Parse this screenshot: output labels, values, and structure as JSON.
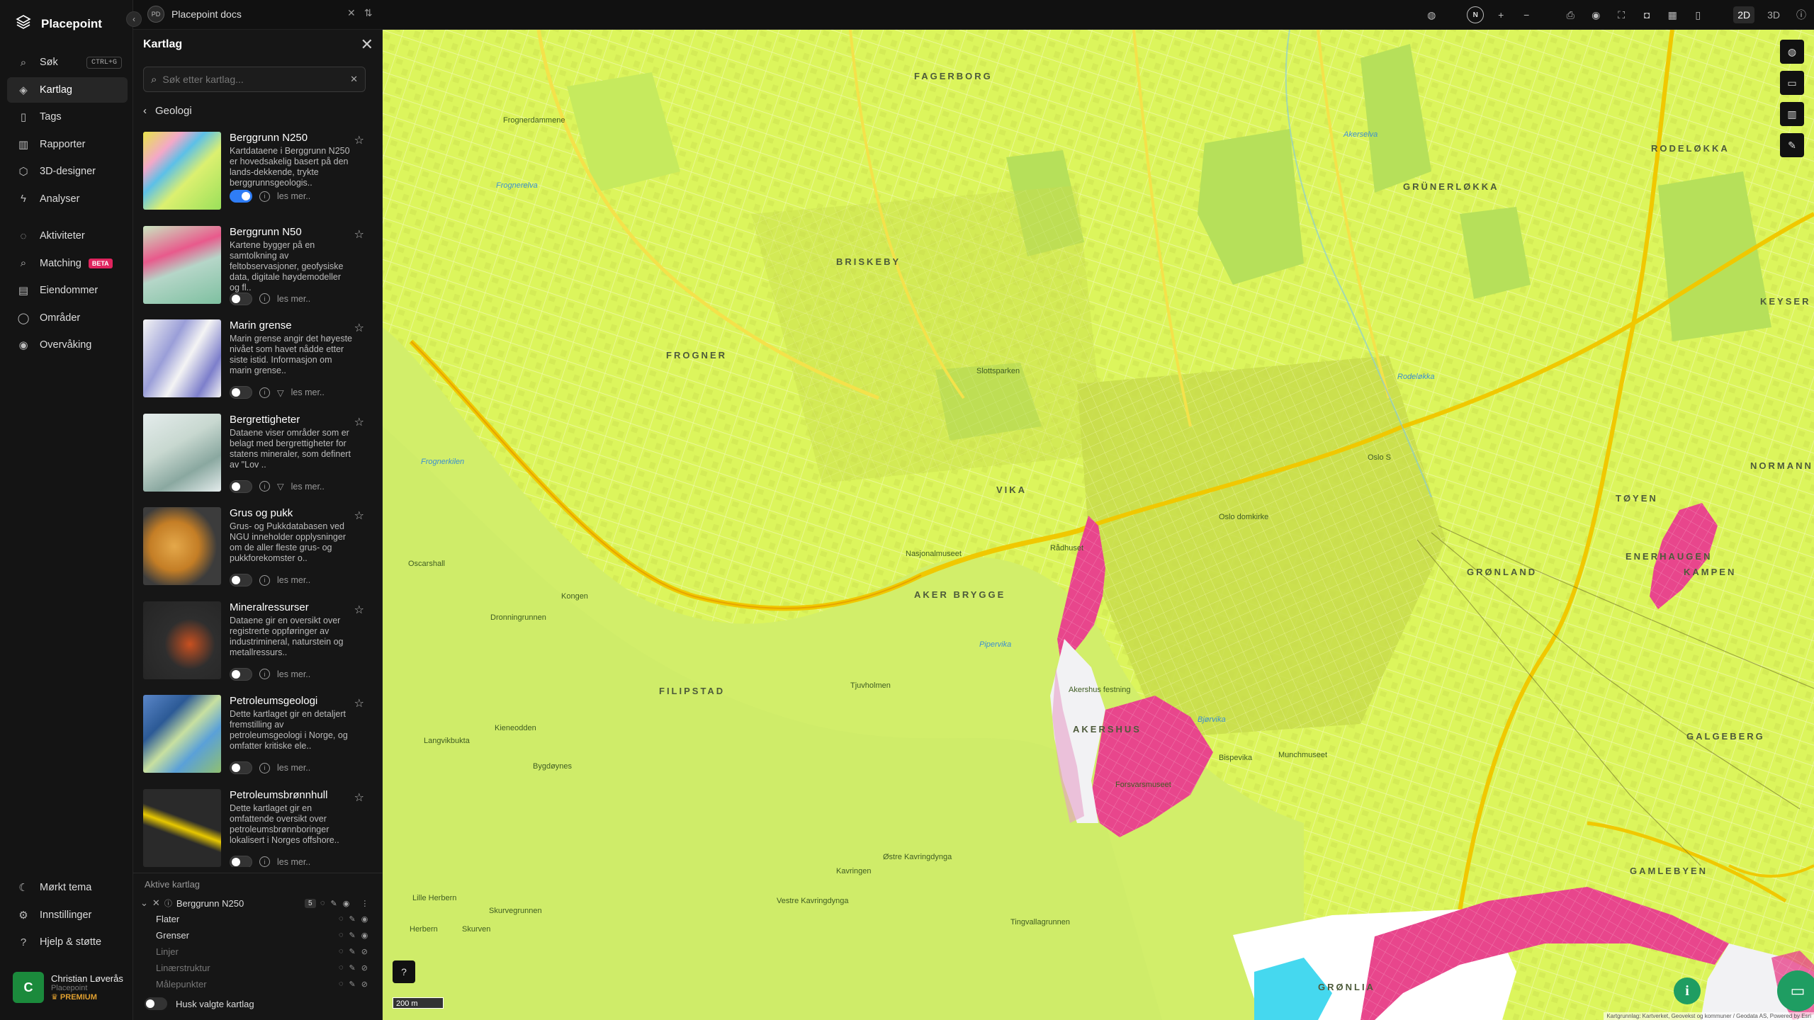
{
  "app": {
    "brand": "Placepoint",
    "document": {
      "badge": "PD",
      "title": "Placepoint docs"
    }
  },
  "nav": {
    "items": [
      {
        "label": "Søk",
        "shortcut": "CTRL+G",
        "icon": "search-icon"
      },
      {
        "label": "Kartlag",
        "icon": "layers-icon",
        "active": true
      },
      {
        "label": "Tags",
        "icon": "bookmark-icon"
      },
      {
        "label": "Rapporter",
        "icon": "bar-chart-icon"
      },
      {
        "label": "3D-designer",
        "icon": "cube-icon"
      },
      {
        "label": "Analyser",
        "icon": "bolt-icon"
      }
    ],
    "items2": [
      {
        "label": "Aktiviteter",
        "icon": "activity-icon"
      },
      {
        "label": "Matching",
        "badge": "BETA",
        "icon": "match-icon"
      },
      {
        "label": "Eiendommer",
        "icon": "building-icon"
      },
      {
        "label": "Områder",
        "icon": "area-icon"
      },
      {
        "label": "Overvåking",
        "icon": "monitor-icon"
      }
    ],
    "bottom": [
      {
        "label": "Mørkt tema",
        "icon": "moon-icon"
      },
      {
        "label": "Innstillinger",
        "icon": "gear-icon"
      },
      {
        "label": "Hjelp & støtte",
        "icon": "help-icon"
      }
    ],
    "user": {
      "initial": "C",
      "name": "Christian Løverås",
      "org": "Placepoint",
      "tier": "PREMIUM"
    }
  },
  "toolbar": {
    "mode_2d": "2D",
    "mode_3d": "3D",
    "compass": "N"
  },
  "panel": {
    "title": "Kartlag",
    "search_placeholder": "Søk etter kartlag...",
    "breadcrumb": "Geologi",
    "layers": [
      {
        "title": "Berggrunn N250",
        "desc": "Kartdataene i Berggrunn N250 er hovedsakelig basert på den lands-dekkende, trykte berggrunnsgeologis..",
        "more": "les mer..",
        "on": true,
        "filter": false
      },
      {
        "title": "Berggrunn N50",
        "desc": "Kartene bygger på en samtolkning av feltobservasjoner, geofysiske data, digitale høydemodeller og fl..",
        "more": "les mer..",
        "on": false,
        "filter": false
      },
      {
        "title": "Marin grense",
        "desc": "Marin grense angir det høyeste nivået som havet nådde etter siste istid. Informasjon om marin grense..",
        "more": "les mer..",
        "on": false,
        "filter": true
      },
      {
        "title": "Bergrettigheter",
        "desc": "Dataene viser områder som er belagt med bergrettigheter for statens mineraler, som definert av \"Lov ..",
        "more": "les mer..",
        "on": false,
        "filter": true
      },
      {
        "title": "Grus og pukk",
        "desc": "Grus- og Pukkdatabasen ved NGU inneholder opplysninger om de aller fleste grus- og pukkforekomster o..",
        "more": "les mer..",
        "on": false,
        "filter": false
      },
      {
        "title": "Mineralressurser",
        "desc": "Dataene gir en oversikt over registrerte oppføringer av industrimineral, naturstein og metallressurs..",
        "more": "les mer..",
        "on": false,
        "filter": false
      },
      {
        "title": "Petroleumsgeologi",
        "desc": "Dette kartlaget gir en detaljert fremstilling av petroleumsgeologi i Norge, og omfatter kritiske ele..",
        "more": "les mer..",
        "on": false,
        "filter": false
      },
      {
        "title": "Petroleumsbrønnhull",
        "desc": "Dette kartlaget gir en omfattende oversikt over petroleumsbrønnboringer lokalisert i Norges offshore..",
        "more": "les mer..",
        "on": false,
        "filter": false
      }
    ],
    "active_title": "Aktive kartlag",
    "active_layer": {
      "name": "Berggrunn N250",
      "count": "5"
    },
    "sublayers": [
      {
        "name": "Flater",
        "dim": false
      },
      {
        "name": "Grenser",
        "dim": false
      },
      {
        "name": "Linjer",
        "dim": true
      },
      {
        "name": "Linærstruktur",
        "dim": true
      },
      {
        "name": "Målepunkter",
        "dim": true
      }
    ],
    "remember": "Husk valgte kartlag"
  },
  "map": {
    "scale": "200 m",
    "attribution": "Kartgrunnlag: Kartverket, Geovekst og kommuner / Geodata AS, Powered by Esri",
    "districts": [
      "FAGERBORG",
      "RODELØKKA",
      "GRÜNERLØKKA",
      "BRISKEBY",
      "FROGNER",
      "AKER BRYGGE",
      "FILIPSTAD",
      "AKERSHUS",
      "TØYEN",
      "GRØNLAND",
      "ENERHAUGEN",
      "KAMPEN",
      "GALGEBERG",
      "GAMLEBYEN",
      "VIKA",
      "KEYSER",
      "NORMANN",
      "GRØNLIA"
    ],
    "labels": [
      "Frognerelva",
      "Akerselva",
      "Frognerkilen",
      "Pipervika",
      "Bjørvika",
      "Tjuvholmen",
      "Frognerdammene",
      "Langvikbukta",
      "Kongen",
      "Dronningrunnen",
      "Kavringen",
      "Østre Kavringdynga",
      "Vestre Kavringdynga",
      "Tingvallagrunnen",
      "Lille Herbern",
      "Herbern",
      "Skurven",
      "Skurvegrunnen",
      "Kieneodden",
      "Bygdøynes",
      "Oscarshall",
      "Rodeløkka",
      "Bispevika",
      "Munchmuseet",
      "Akershus festning",
      "Forsvarsmuseet",
      "Oslo domkirke",
      "Slottsparken",
      "Rådhuset",
      "Nasjonalmuseet",
      "Oslo S"
    ]
  },
  "colors": {
    "accent": "#2f7df6",
    "geology_yellow": "#dcf55c",
    "geology_pink": "#e8468c",
    "geology_cyan": "#45d8ef",
    "brand_green": "#1f9d62"
  }
}
